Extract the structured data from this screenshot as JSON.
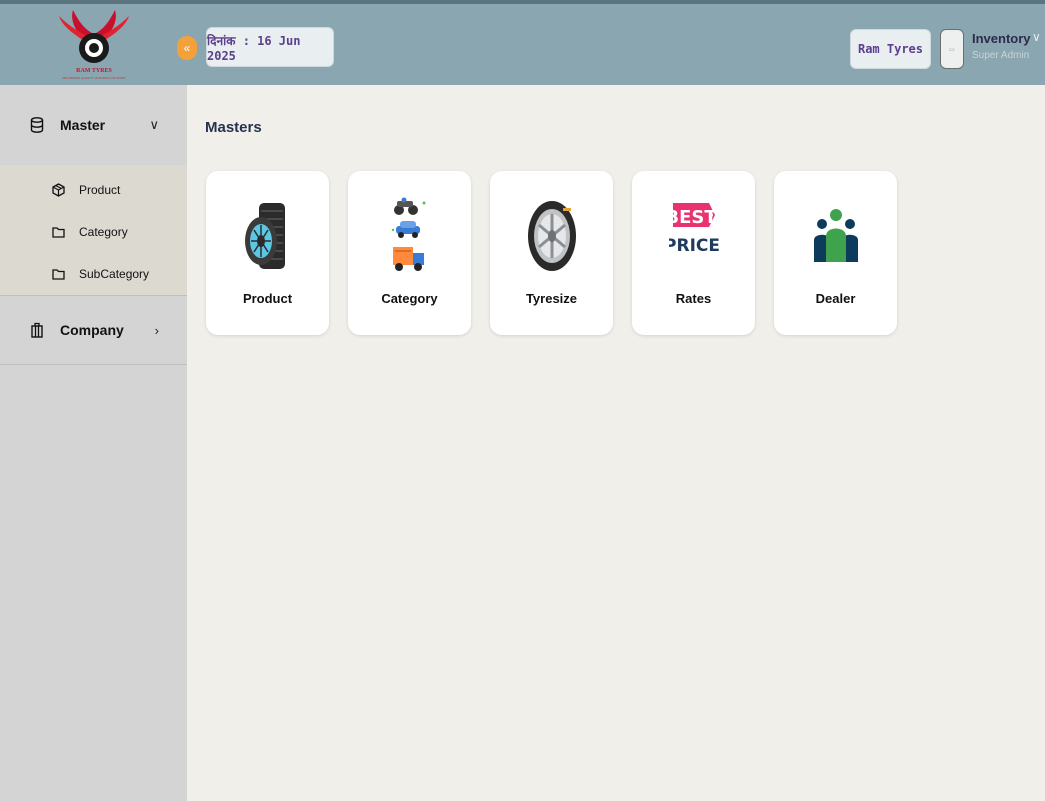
{
  "header": {
    "logo_text": "RAM TYRES",
    "logo_tagline": "DELIVERING QUALITY, BUILDING ON TRUST",
    "collapse_icon": "«",
    "date_label": "दिनांक : 16 Jun 2025",
    "company": "Ram Tyres",
    "user": {
      "name": "Inventory",
      "role": "Super Admin"
    }
  },
  "sidebar": {
    "master": {
      "label": "Master",
      "items": [
        {
          "label": "Product"
        },
        {
          "label": "Category"
        },
        {
          "label": "SubCategory"
        }
      ]
    },
    "company": {
      "label": "Company"
    }
  },
  "main": {
    "title": "Masters",
    "cards": [
      {
        "label": "Product",
        "icon": "tyre-stack-icon"
      },
      {
        "label": "Category",
        "icon": "vehicles-icon"
      },
      {
        "label": "Tyresize",
        "icon": "tyre-wheel-icon"
      },
      {
        "label": "Rates",
        "icon": "best-price-icon"
      },
      {
        "label": "Dealer",
        "icon": "people-group-icon"
      }
    ]
  },
  "rates_icon_text": {
    "line1": "BEST",
    "line2": "PRICE"
  },
  "colors": {
    "header_bg": "#8aa6b1",
    "sidebar_bg": "#d4d4d4",
    "main_bg": "#f0efe9",
    "accent_orange": "#f5a139",
    "accent_purple": "#5b3f8c"
  }
}
